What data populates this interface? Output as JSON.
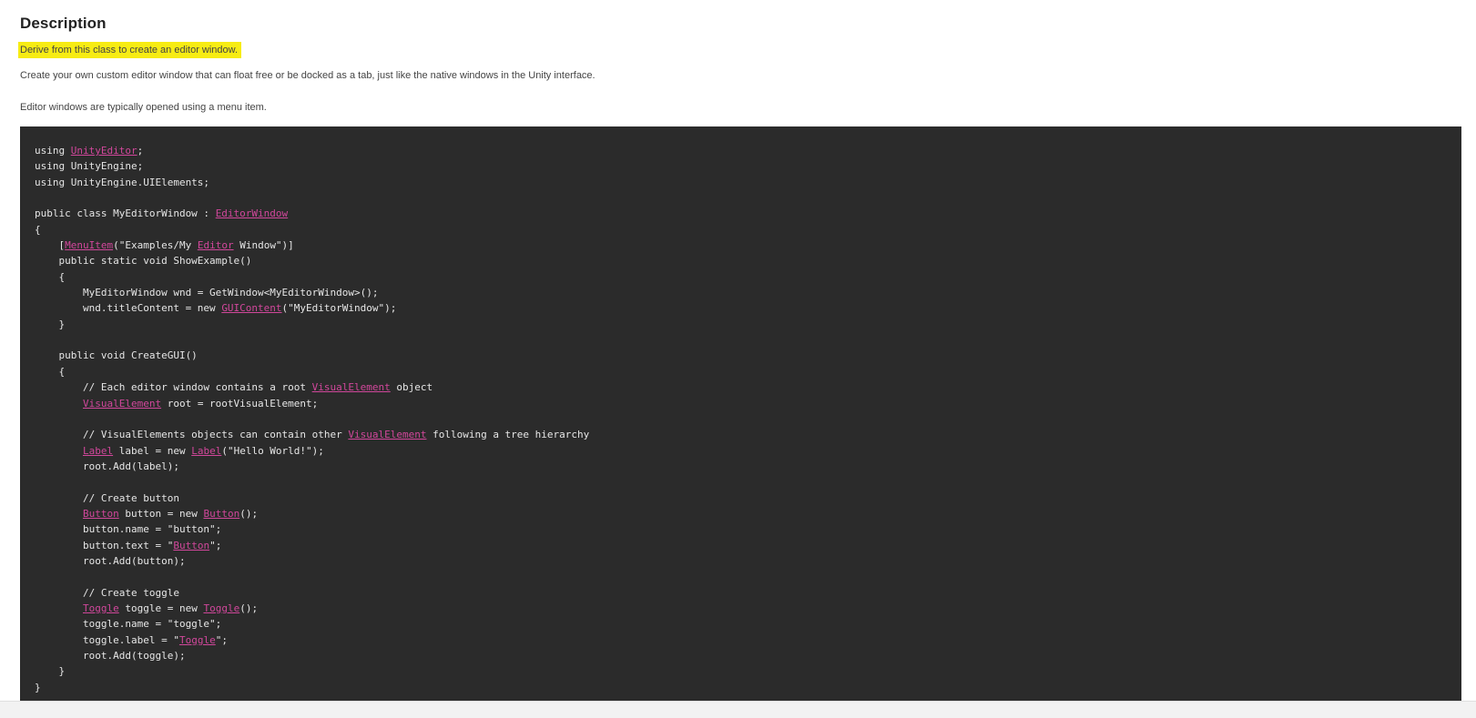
{
  "section": {
    "title": "Description",
    "highlighted_summary": "Derive from this class to create an editor window.",
    "paragraph_1": "Create your own custom editor window that can float free or be docked as a tab, just like the native windows in the Unity interface.",
    "paragraph_2": "Editor windows are typically opened using a menu item."
  },
  "colors": {
    "highlight": "#f7ec13",
    "code_background": "#2b2b2b",
    "code_text": "#e6e6e6",
    "code_link": "#d1479b"
  },
  "code": {
    "lines": [
      [
        {
          "t": "using "
        },
        {
          "t": "UnityEditor",
          "link": true
        },
        {
          "t": ";"
        }
      ],
      [
        {
          "t": "using UnityEngine;"
        }
      ],
      [
        {
          "t": "using UnityEngine.UIElements;"
        }
      ],
      [
        {
          "t": ""
        }
      ],
      [
        {
          "t": "public class MyEditorWindow : "
        },
        {
          "t": "EditorWindow",
          "link": true
        }
      ],
      [
        {
          "t": "{"
        }
      ],
      [
        {
          "t": "    ["
        },
        {
          "t": "MenuItem",
          "link": true
        },
        {
          "t": "(\"Examples/My "
        },
        {
          "t": "Editor",
          "link": true
        },
        {
          "t": " Window\")]"
        }
      ],
      [
        {
          "t": "    public static void ShowExample()"
        }
      ],
      [
        {
          "t": "    {"
        }
      ],
      [
        {
          "t": "        MyEditorWindow wnd = GetWindow<MyEditorWindow>();"
        }
      ],
      [
        {
          "t": "        wnd.titleContent = new "
        },
        {
          "t": "GUIContent",
          "link": true
        },
        {
          "t": "(\"MyEditorWindow\");"
        }
      ],
      [
        {
          "t": "    }"
        }
      ],
      [
        {
          "t": ""
        }
      ],
      [
        {
          "t": "    public void CreateGUI()"
        }
      ],
      [
        {
          "t": "    {"
        }
      ],
      [
        {
          "t": "        // Each editor window contains a root "
        },
        {
          "t": "VisualElement",
          "link": true
        },
        {
          "t": " object"
        }
      ],
      [
        {
          "t": "        "
        },
        {
          "t": "VisualElement",
          "link": true
        },
        {
          "t": " root = rootVisualElement;"
        }
      ],
      [
        {
          "t": ""
        }
      ],
      [
        {
          "t": "        // VisualElements objects can contain other "
        },
        {
          "t": "VisualElement",
          "link": true
        },
        {
          "t": " following a tree hierarchy"
        }
      ],
      [
        {
          "t": "        "
        },
        {
          "t": "Label",
          "link": true
        },
        {
          "t": " label = new "
        },
        {
          "t": "Label",
          "link": true
        },
        {
          "t": "(\"Hello World!\");"
        }
      ],
      [
        {
          "t": "        root.Add(label);"
        }
      ],
      [
        {
          "t": ""
        }
      ],
      [
        {
          "t": "        // Create button"
        }
      ],
      [
        {
          "t": "        "
        },
        {
          "t": "Button",
          "link": true
        },
        {
          "t": " button = new "
        },
        {
          "t": "Button",
          "link": true
        },
        {
          "t": "();"
        }
      ],
      [
        {
          "t": "        button.name = \"button\";"
        }
      ],
      [
        {
          "t": "        button.text = \""
        },
        {
          "t": "Button",
          "link": true
        },
        {
          "t": "\";"
        }
      ],
      [
        {
          "t": "        root.Add(button);"
        }
      ],
      [
        {
          "t": ""
        }
      ],
      [
        {
          "t": "        // Create toggle"
        }
      ],
      [
        {
          "t": "        "
        },
        {
          "t": "Toggle",
          "link": true
        },
        {
          "t": " toggle = new "
        },
        {
          "t": "Toggle",
          "link": true
        },
        {
          "t": "();"
        }
      ],
      [
        {
          "t": "        toggle.name = \"toggle\";"
        }
      ],
      [
        {
          "t": "        toggle.label = \""
        },
        {
          "t": "Toggle",
          "link": true
        },
        {
          "t": "\";"
        }
      ],
      [
        {
          "t": "        root.Add(toggle);"
        }
      ],
      [
        {
          "t": "    }"
        }
      ],
      [
        {
          "t": "}"
        }
      ]
    ]
  }
}
